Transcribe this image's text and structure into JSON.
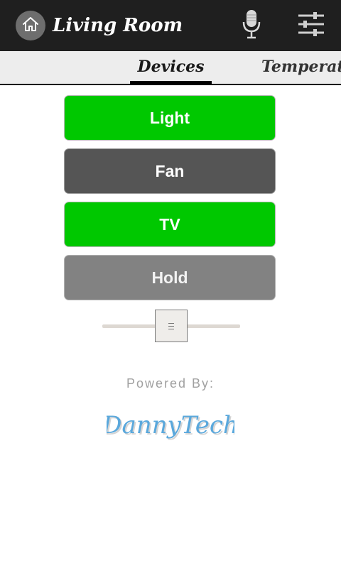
{
  "header": {
    "title": "Living Room",
    "home_icon": "home-icon",
    "mic_icon": "microphone-icon",
    "settings_icon": "sliders-icon"
  },
  "tabs": [
    {
      "label": "Devices",
      "selected": true
    },
    {
      "label": "Temperature",
      "selected": false
    }
  ],
  "devices": [
    {
      "label": "Light",
      "state": "on",
      "color": "#00c800"
    },
    {
      "label": "Fan",
      "state": "off",
      "color": "#555555"
    },
    {
      "label": "TV",
      "state": "on",
      "color": "#00c800"
    },
    {
      "label": "Hold",
      "state": "hold",
      "color": "#828282"
    }
  ],
  "slider": {
    "value_percent": 50
  },
  "footer": {
    "powered_by": "Powered By:",
    "logo_text": "DannyTech"
  },
  "colors": {
    "accent_on": "#00c800",
    "action_bar": "#1f1f1f",
    "logo": "#5aa8dc"
  }
}
